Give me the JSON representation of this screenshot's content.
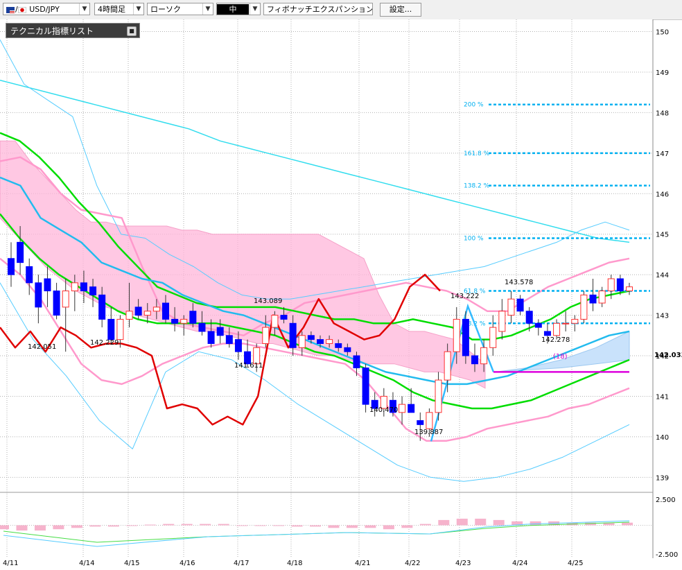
{
  "toolbar": {
    "pair": "USD/JPY",
    "timeframe": "4時間足",
    "chart_style": "ローソク",
    "size": "中",
    "tool": "フィボナッチエクスパンション",
    "settings_label": "設定..."
  },
  "tech_panel": {
    "label": "テクニカル指標リスト"
  },
  "price_axis": {
    "ticks": [
      "150",
      "149",
      "148",
      "147",
      "146",
      "145",
      "144",
      "143",
      "142",
      "141",
      "140",
      "139"
    ],
    "current_price": "142.033"
  },
  "osc_axis": {
    "ticks": [
      "2.500",
      "-2.500"
    ]
  },
  "date_axis": {
    "labels": [
      "4/11",
      "4/14",
      "4/15",
      "4/16",
      "4/17",
      "4/18",
      "4/21",
      "4/22",
      "4/23",
      "4/24",
      "4/25"
    ]
  },
  "fib_levels": [
    {
      "label": "200  %",
      "price": 148.2
    },
    {
      "label": "161.8  %",
      "price": 147.0
    },
    {
      "label": "138.2  %",
      "price": 146.2
    },
    {
      "label": "100  %",
      "price": 144.9
    },
    {
      "label": "61.8  %",
      "price": 143.6
    },
    {
      "label": "38.2  %",
      "price": 142.8
    }
  ],
  "annotations": [
    {
      "text": "142.051"
    },
    {
      "text": "142.229"
    },
    {
      "text": "141.611"
    },
    {
      "text": "143.089"
    },
    {
      "text": "140.470"
    },
    {
      "text": "139.887"
    },
    {
      "text": "143.222"
    },
    {
      "text": "143.578"
    },
    {
      "text": "142.278"
    },
    {
      "text": "(18)"
    }
  ],
  "colors": {
    "bull": "#ff3030",
    "bear": "#0000ff",
    "cloud": "#ffb6d9",
    "fib": "#00b0f0",
    "ma_red": "#e00000",
    "ma_green": "#00dd00",
    "bb_pink": "#ff99cc",
    "bb_cyan": "#55ccff"
  },
  "chart_data": {
    "type": "candlestick",
    "symbol": "USD/JPY",
    "timeframe": "4H",
    "ylim": [
      138.8,
      150.3
    ],
    "x_labels": [
      "4/11",
      "4/14",
      "4/15",
      "4/16",
      "4/17",
      "4/18",
      "4/21",
      "4/22",
      "4/23",
      "4/24",
      "4/25"
    ],
    "candles": [
      {
        "o": 144.4,
        "h": 144.8,
        "l": 143.7,
        "c": 144.0
      },
      {
        "o": 144.8,
        "h": 145.2,
        "l": 144.0,
        "c": 144.3
      },
      {
        "o": 144.2,
        "h": 144.4,
        "l": 143.5,
        "c": 143.8
      },
      {
        "o": 143.8,
        "h": 144.0,
        "l": 142.8,
        "c": 143.2
      },
      {
        "o": 143.9,
        "h": 144.2,
        "l": 143.2,
        "c": 143.6
      },
      {
        "o": 143.6,
        "h": 143.8,
        "l": 142.9,
        "c": 143.0
      },
      {
        "o": 143.2,
        "h": 143.9,
        "l": 142.1,
        "c": 143.6
      },
      {
        "o": 143.6,
        "h": 144.0,
        "l": 143.1,
        "c": 143.8
      },
      {
        "o": 143.8,
        "h": 144.1,
        "l": 143.3,
        "c": 143.6
      },
      {
        "o": 143.7,
        "h": 143.9,
        "l": 143.2,
        "c": 143.5
      },
      {
        "o": 143.5,
        "h": 143.7,
        "l": 142.7,
        "c": 142.9
      },
      {
        "o": 142.9,
        "h": 143.2,
        "l": 142.3,
        "c": 142.4
      },
      {
        "o": 142.4,
        "h": 143.0,
        "l": 142.2,
        "c": 142.9
      },
      {
        "o": 142.9,
        "h": 143.8,
        "l": 142.7,
        "c": 143.1
      },
      {
        "o": 143.2,
        "h": 143.4,
        "l": 142.9,
        "c": 143.0
      },
      {
        "o": 143.0,
        "h": 143.3,
        "l": 142.8,
        "c": 143.1
      },
      {
        "o": 143.1,
        "h": 143.4,
        "l": 142.9,
        "c": 143.2
      },
      {
        "o": 143.3,
        "h": 143.5,
        "l": 142.8,
        "c": 142.9
      },
      {
        "o": 142.9,
        "h": 143.2,
        "l": 142.6,
        "c": 142.8
      },
      {
        "o": 142.8,
        "h": 143.0,
        "l": 142.5,
        "c": 142.9
      },
      {
        "o": 143.1,
        "h": 143.3,
        "l": 142.7,
        "c": 142.8
      },
      {
        "o": 142.8,
        "h": 143.1,
        "l": 142.5,
        "c": 142.6
      },
      {
        "o": 142.6,
        "h": 142.9,
        "l": 142.2,
        "c": 142.3
      },
      {
        "o": 142.7,
        "h": 142.9,
        "l": 142.3,
        "c": 142.5
      },
      {
        "o": 142.5,
        "h": 142.7,
        "l": 142.2,
        "c": 142.3
      },
      {
        "o": 142.4,
        "h": 142.6,
        "l": 141.9,
        "c": 142.1
      },
      {
        "o": 142.1,
        "h": 142.4,
        "l": 141.7,
        "c": 141.8
      },
      {
        "o": 141.8,
        "h": 142.3,
        "l": 141.6,
        "c": 142.2
      },
      {
        "o": 142.3,
        "h": 143.0,
        "l": 142.2,
        "c": 142.7
      },
      {
        "o": 142.7,
        "h": 143.1,
        "l": 142.5,
        "c": 143.0
      },
      {
        "o": 143.0,
        "h": 143.2,
        "l": 142.8,
        "c": 142.9
      },
      {
        "o": 142.8,
        "h": 143.0,
        "l": 142.0,
        "c": 142.2
      },
      {
        "o": 142.2,
        "h": 142.6,
        "l": 142.0,
        "c": 142.5
      },
      {
        "o": 142.5,
        "h": 142.6,
        "l": 142.3,
        "c": 142.4
      },
      {
        "o": 142.4,
        "h": 142.5,
        "l": 142.2,
        "c": 142.3
      },
      {
        "o": 142.3,
        "h": 142.5,
        "l": 142.2,
        "c": 142.4
      },
      {
        "o": 142.3,
        "h": 142.4,
        "l": 142.1,
        "c": 142.2
      },
      {
        "o": 142.2,
        "h": 142.3,
        "l": 142.0,
        "c": 142.1
      },
      {
        "o": 142.0,
        "h": 142.1,
        "l": 141.5,
        "c": 141.7
      },
      {
        "o": 141.7,
        "h": 141.8,
        "l": 140.6,
        "c": 140.8
      },
      {
        "o": 140.9,
        "h": 141.1,
        "l": 140.5,
        "c": 140.7
      },
      {
        "o": 140.7,
        "h": 141.2,
        "l": 140.5,
        "c": 141.0
      },
      {
        "o": 140.9,
        "h": 141.1,
        "l": 140.5,
        "c": 140.6
      },
      {
        "o": 140.6,
        "h": 141.0,
        "l": 140.3,
        "c": 140.8
      },
      {
        "o": 140.8,
        "h": 141.2,
        "l": 140.6,
        "c": 140.6
      },
      {
        "o": 140.4,
        "h": 140.6,
        "l": 139.9,
        "c": 140.3
      },
      {
        "o": 140.2,
        "h": 140.7,
        "l": 140.0,
        "c": 140.6
      },
      {
        "o": 140.6,
        "h": 141.6,
        "l": 140.4,
        "c": 141.4
      },
      {
        "o": 141.4,
        "h": 142.3,
        "l": 141.1,
        "c": 142.1
      },
      {
        "o": 142.1,
        "h": 143.2,
        "l": 141.8,
        "c": 142.9
      },
      {
        "o": 142.9,
        "h": 143.1,
        "l": 141.8,
        "c": 142.0
      },
      {
        "o": 142.0,
        "h": 142.3,
        "l": 141.6,
        "c": 141.8
      },
      {
        "o": 141.8,
        "h": 142.4,
        "l": 141.6,
        "c": 142.2
      },
      {
        "o": 142.2,
        "h": 143.0,
        "l": 142.0,
        "c": 142.7
      },
      {
        "o": 142.6,
        "h": 143.4,
        "l": 142.4,
        "c": 143.1
      },
      {
        "o": 143.0,
        "h": 143.6,
        "l": 142.8,
        "c": 143.4
      },
      {
        "o": 143.4,
        "h": 143.5,
        "l": 143.0,
        "c": 143.1
      },
      {
        "o": 143.1,
        "h": 143.2,
        "l": 142.6,
        "c": 142.8
      },
      {
        "o": 142.8,
        "h": 142.9,
        "l": 142.5,
        "c": 142.7
      },
      {
        "o": 142.6,
        "h": 142.8,
        "l": 142.3,
        "c": 142.5
      },
      {
        "o": 142.5,
        "h": 142.9,
        "l": 142.4,
        "c": 142.8
      },
      {
        "o": 142.8,
        "h": 143.1,
        "l": 142.6,
        "c": 142.8
      },
      {
        "o": 142.8,
        "h": 143.0,
        "l": 142.6,
        "c": 142.9
      },
      {
        "o": 142.9,
        "h": 143.6,
        "l": 142.8,
        "c": 143.5
      },
      {
        "o": 143.5,
        "h": 143.9,
        "l": 143.1,
        "c": 143.3
      },
      {
        "o": 143.3,
        "h": 143.7,
        "l": 143.2,
        "c": 143.6
      },
      {
        "o": 143.6,
        "h": 144.0,
        "l": 143.4,
        "c": 143.9
      },
      {
        "o": 143.9,
        "h": 144.0,
        "l": 143.5,
        "c": 143.6
      },
      {
        "o": 143.6,
        "h": 143.8,
        "l": 143.5,
        "c": 143.7
      }
    ],
    "cloud_top": [
      147.3,
      147.3,
      146.8,
      146.4,
      146.0,
      145.6,
      145.3,
      145.3,
      145.2,
      145.2,
      145.2,
      145.2,
      145.1,
      145.1,
      145.0,
      145.0,
      145.0,
      145.0,
      145.0,
      145.0,
      145.0,
      145.0,
      144.8,
      144.6,
      144.4,
      143.5,
      142.8,
      142.6,
      142.6,
      142.5,
      142.4,
      142.1,
      141.8
    ],
    "cloud_bottom": [
      145.4,
      145.0,
      144.6,
      144.2,
      143.9,
      143.6,
      143.4,
      143.2,
      143.1,
      143.0,
      142.9,
      142.8,
      142.7,
      142.6,
      142.6,
      142.5,
      142.4,
      142.3,
      142.3,
      142.2,
      142.1,
      142.0,
      142.0,
      141.9,
      141.8,
      141.8,
      141.8,
      141.7,
      141.6,
      141.6,
      141.5,
      141.4,
      141.2
    ],
    "ma_green_upper": [
      147.5,
      147.3,
      146.9,
      146.4,
      145.8,
      145.3,
      144.7,
      144.2,
      143.7,
      143.5,
      143.3,
      143.2,
      143.2,
      143.2,
      143.2,
      143.1,
      143.0,
      142.9,
      142.9,
      142.8,
      142.8,
      142.9,
      142.8,
      142.7,
      142.4,
      142.4,
      142.5,
      142.7,
      142.9,
      143.2,
      143.4,
      143.5,
      143.6
    ],
    "ma_green_lower": [
      145.5,
      144.9,
      144.4,
      144.0,
      143.7,
      143.4,
      143.1,
      142.9,
      142.8,
      142.8,
      142.8,
      142.8,
      142.7,
      142.6,
      142.5,
      142.3,
      142.1,
      142.0,
      141.8,
      141.6,
      141.4,
      141.1,
      140.9,
      140.8,
      140.7,
      140.7,
      140.8,
      140.9,
      141.1,
      141.3,
      141.5,
      141.7,
      141.9
    ],
    "ma_cyan": [
      146.4,
      146.2,
      145.4,
      145.1,
      144.8,
      144.3,
      144.1,
      143.9,
      143.8,
      143.5,
      143.3,
      143.1,
      143.0,
      142.8,
      142.6,
      142.4,
      142.2,
      142.0,
      141.8,
      141.6,
      141.5,
      141.4,
      141.3,
      141.3,
      141.4,
      141.5,
      141.7,
      141.9,
      142.1,
      142.3,
      142.5,
      142.6
    ],
    "bb_pink_upper": [
      146.8,
      146.9,
      146.6,
      146.0,
      145.6,
      145.5,
      145.4,
      144.2,
      143.1,
      142.8,
      142.7,
      142.6,
      142.5,
      142.8,
      143.0,
      143.3,
      143.4,
      143.5,
      143.6,
      143.7,
      143.8,
      143.7,
      143.6,
      143.4,
      143.1,
      143.1,
      143.4,
      143.7,
      143.9,
      144.1,
      144.3,
      144.4
    ],
    "bb_pink_lower": [
      144.4,
      144.0,
      143.4,
      142.6,
      141.8,
      141.4,
      141.3,
      141.5,
      141.8,
      142.0,
      142.2,
      142.3,
      142.3,
      142.2,
      142.1,
      142.0,
      141.9,
      141.8,
      141.4,
      140.8,
      140.2,
      139.9,
      139.9,
      140.0,
      140.2,
      140.3,
      140.4,
      140.5,
      140.7,
      140.8,
      141.0,
      141.2
    ],
    "bb_cyan_upper": [
      149.8,
      148.7,
      148.3,
      147.9,
      146.2,
      145.0,
      144.9,
      144.5,
      144.2,
      143.8,
      143.5,
      143.4,
      143.4,
      143.5,
      143.6,
      143.7,
      143.8,
      143.9,
      144.0,
      144.1,
      144.2,
      144.4,
      144.6,
      144.8,
      145.1,
      145.3,
      145.1
    ],
    "bb_cyan_lower": [
      143.8,
      142.4,
      141.5,
      140.4,
      139.7,
      141.6,
      142.1,
      141.9,
      141.4,
      140.8,
      140.3,
      139.8,
      139.3,
      139.0,
      138.9,
      139.0,
      139.2,
      139.5,
      139.9,
      140.3
    ],
    "ma_long": [
      148.8,
      148.6,
      148.4,
      148.2,
      148.0,
      147.8,
      147.6,
      147.3,
      147.1,
      146.9,
      146.7,
      146.5,
      146.3,
      146.1,
      145.9,
      145.7,
      145.5,
      145.3,
      145.1,
      144.9,
      144.8
    ],
    "red_line": [
      142.7,
      142.2,
      142.6,
      142.1,
      142.7,
      142.5,
      142.2,
      142.3,
      142.3,
      142.2,
      142.0,
      140.7,
      140.8,
      140.7,
      140.3,
      140.5,
      140.3,
      141.0,
      143.0,
      142.2,
      142.7,
      143.4,
      142.8,
      142.6,
      142.4,
      142.5,
      142.9,
      143.7,
      144.0,
      143.6
    ],
    "fib_expansion": {
      "A": 139.887,
      "B": 143.222,
      "C": 141.6
    },
    "oscillator": {
      "ylim": [
        -2.5,
        2.5
      ],
      "hist": [
        -0.3,
        -0.4,
        -0.4,
        -0.3,
        -0.2,
        -0.1,
        -0.1,
        0,
        0.05,
        0.1,
        0.1,
        0.1,
        0.1,
        0,
        0,
        0,
        -0.1,
        -0.1,
        -0.2,
        -0.2,
        -0.2,
        -0.3,
        -0.2,
        0.1,
        0.4,
        0.5,
        0.5,
        0.4,
        0.3,
        0.3,
        0.3,
        0.2,
        0.2,
        0.2,
        0.2
      ]
    }
  }
}
